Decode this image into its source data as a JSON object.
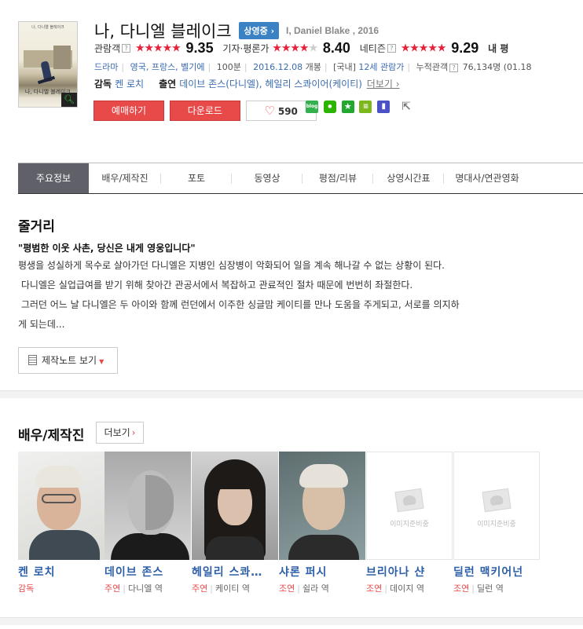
{
  "movie": {
    "title_kr": "나, 다니엘 블레이크",
    "status_badge": "상영중 ›",
    "title_en": "I, Daniel Blake , 2016",
    "poster_top_text": "나, 다니엘 블레이크",
    "poster_title": "나, 다니엘 블레이크"
  },
  "ratings": {
    "audience": {
      "label": "관람객",
      "help": "?",
      "stars": "★★★★★",
      "score": "9.35"
    },
    "critic": {
      "label": "기자·평론가",
      "stars": "★★★★★",
      "score": "8.40"
    },
    "netizen": {
      "label": "네티즌",
      "help": "?",
      "stars": "★★★★★",
      "score": "9.29"
    },
    "mine": {
      "label": "내 평"
    }
  },
  "info": {
    "genre": "드라마",
    "countries": "영국, 프랑스, 벨기에",
    "runtime": "100분",
    "release": "2016.12.08",
    "release_suffix": "개봉",
    "grade_prefix": "[국내]",
    "grade": "12세 관람가",
    "cumulative_label": "누적관객",
    "cumulative_help": "?",
    "cumulative_value": "76,134명",
    "cumulative_date": "(01.18"
  },
  "crew": {
    "director_label": "감독",
    "director": "켄 로치",
    "cast_label": "출연",
    "cast_1": "데이브 존스(다니엘),",
    "cast_2": "헤일리 스콰이어(케이티)",
    "more": "더보기 ›"
  },
  "buttons": {
    "reserve": "예매하기",
    "download": "다운로드",
    "like_count": "590"
  },
  "share": {
    "blog": "blog",
    "cafe": "●",
    "star": "★",
    "bars": "≡",
    "pinn": "▮",
    "arrow": "⇱"
  },
  "tabs": [
    "주요정보",
    "배우/제작진",
    "포토",
    "동영상",
    "평점/리뷰",
    "상영시간표",
    "명대사/연관영화"
  ],
  "synopsis": {
    "heading": "줄거리",
    "tagline": "\"평범한 이웃 사촌, 당신은 내게 영웅입니다\"",
    "line1": "평생을 성실하게 목수로 살아가던 다니엘은 지병인 심장병이 악화되어 일을 계속 해나갈 수 없는 상황이 된다.",
    "line2": " 다니엘은 실업급여를 받기 위해 찾아간 관공서에서 복잡하고 관료적인 절차 때문에 번번히 좌절한다.",
    "line3": " 그러던 어느 날 다니엘은 두 아이와 함께 런던에서 이주한 싱글맘 케이티를 만나 도움을 주게되고, 서로를 의지하",
    "line4": "게 되는데...",
    "note_button": "제작노트 보기"
  },
  "cast_section": {
    "heading": "배우/제작진",
    "more": "더보기",
    "people": [
      {
        "name": "켄 로치",
        "role_type": "감독",
        "role": ""
      },
      {
        "name": "데이브 존스",
        "role_type": "주연",
        "role": "다니엘 역"
      },
      {
        "name": "헤일리 스콰…",
        "role_type": "주연",
        "role": "케이티 역"
      },
      {
        "name": "샤론 퍼시",
        "role_type": "조연",
        "role": "쉴라 역"
      },
      {
        "name": "브리아나 샨",
        "role_type": "조연",
        "role": "데이지 역"
      },
      {
        "name": "딜런 맥키어넌",
        "role_type": "조연",
        "role": "딜런 역"
      }
    ],
    "placeholder_text": "이미지준비중"
  },
  "colors": {
    "accent_red": "#e84a4a",
    "link_blue": "#3a6bb0",
    "badge_blue": "#3b82c4",
    "tab_active": "#5f6068"
  }
}
